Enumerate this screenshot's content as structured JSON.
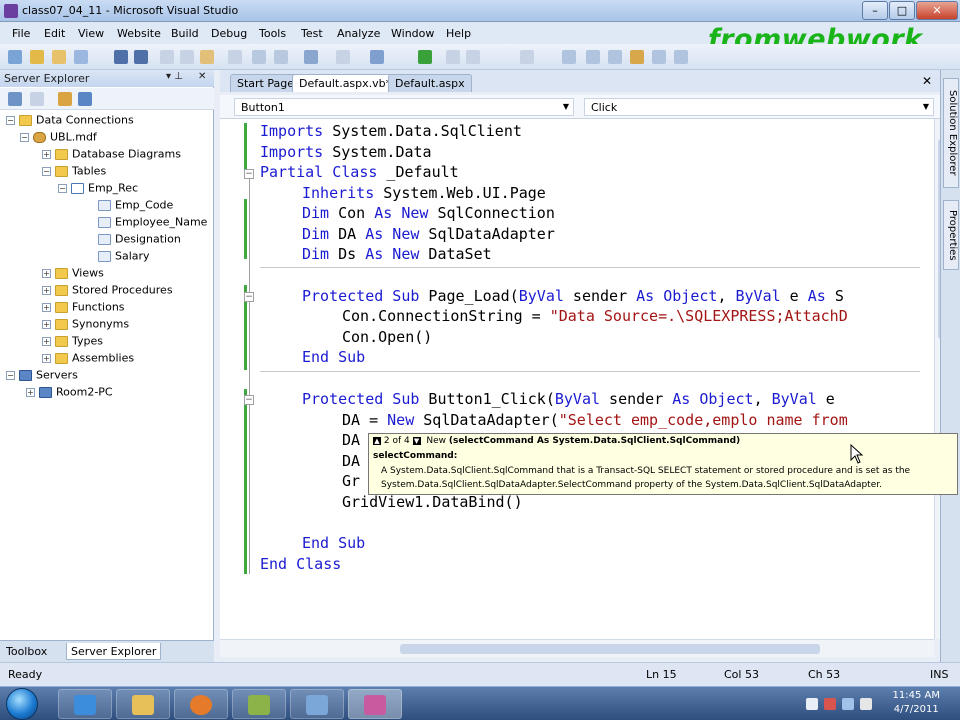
{
  "window": {
    "title": "class07_04_11 - Microsoft Visual Studio",
    "minimize": "–",
    "maximize": "□",
    "close": "✕"
  },
  "watermark": "fromwebwork",
  "menu": [
    "File",
    "Edit",
    "View",
    "Website",
    "Build",
    "Debug",
    "Tools",
    "Test",
    "Analyze",
    "Window",
    "Help"
  ],
  "server_explorer": {
    "title": "Server Explorer",
    "pin": "▾ ⊥",
    "close": "✕",
    "tree": {
      "data_connections": "Data Connections",
      "db": "UBL.mdf",
      "database_diagrams": "Database Diagrams",
      "tables": "Tables",
      "emp_rec": "Emp_Rec",
      "columns": [
        "Emp_Code",
        "Employee_Name",
        "Designation",
        "Salary"
      ],
      "views": "Views",
      "stored_procedures": "Stored Procedures",
      "functions": "Functions",
      "synonyms": "Synonyms",
      "types": "Types",
      "assemblies": "Assemblies",
      "servers": "Servers",
      "room2pc": "Room2-PC"
    },
    "bottom_tabs": [
      "Toolbox",
      "Server Explorer"
    ]
  },
  "doc_tabs": [
    "Start Page",
    "Default.aspx.vb*",
    "Default.aspx"
  ],
  "nav": {
    "object": "Button1",
    "event": "Click"
  },
  "right_tabs": [
    "Solution Explorer",
    "Properties"
  ],
  "code": {
    "l1": "Imports System.Data.SqlClient",
    "l2": "Imports System.Data",
    "l3_kw": "Partial Class",
    "l3_rest": " _Default",
    "l4_kw": "Inherits",
    "l4_rest": " System.Web.UI.Page",
    "l5": "Dim Con As New SqlConnection",
    "l6": "Dim DA As New SqlDataAdapter",
    "l7": "Dim Ds As New DataSet",
    "l8": "Protected Sub Page_Load(ByVal sender As Object, ByVal e As S",
    "l9_a": "Con.ConnectionString = ",
    "l9_str": "\"Data Source=.\\SQLEXPRESS;AttachD",
    "l10": "Con.Open()",
    "l11": "End Sub",
    "l12": "Protected Sub Button1_Click(ByVal sender As Object, ByVal e",
    "l13_a": "DA = ",
    "l13_b": "New",
    "l13_c": " SqlDataAdapter(",
    "l13_str": "\"Select emp_code,emplo name from",
    "l14": "DA",
    "l15": "DA",
    "l16": "Gr",
    "l17": "GridView1.DataBind()",
    "l18": "End Sub",
    "l19": "End Class"
  },
  "tooltip": {
    "counter": "2 of 4",
    "sig_new": "New",
    "sig_params": "(selectCommand As System.Data.SqlClient.SqlCommand)",
    "param_name": "selectCommand:",
    "desc1": "A System.Data.SqlClient.SqlCommand that is a Transact-SQL SELECT statement or stored procedure and is set as the",
    "desc2": "System.Data.SqlClient.SqlDataAdapter.SelectCommand property of the System.Data.SqlClient.SqlDataAdapter."
  },
  "status": {
    "ready": "Ready",
    "ln": "Ln 15",
    "col": "Col 53",
    "ch": "Ch 53",
    "ins": "INS"
  },
  "clock": {
    "time": "11:45 AM",
    "date": "4/7/2011"
  },
  "colors": {
    "keyword": "#1b1bd2",
    "string": "#a31515",
    "watermark": "#18b418"
  }
}
